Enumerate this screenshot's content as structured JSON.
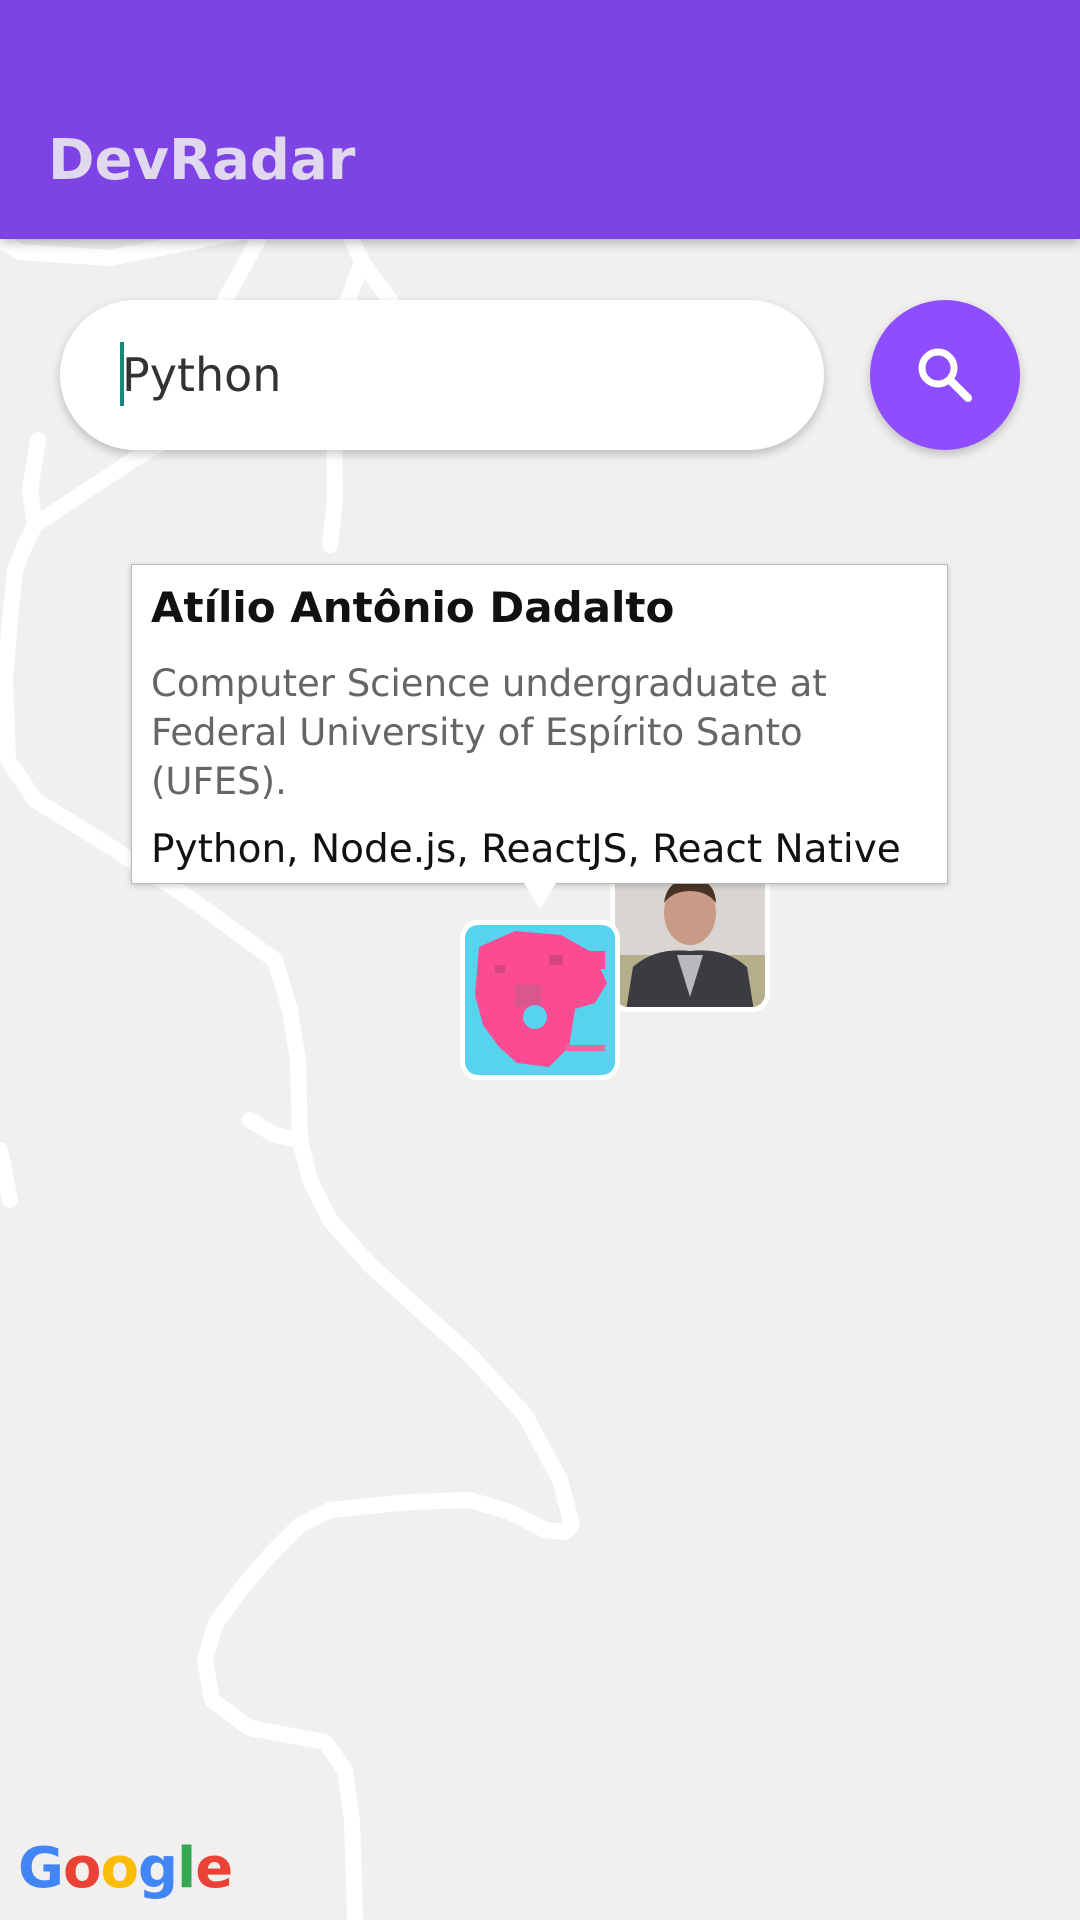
{
  "app": {
    "title": "DevRadar",
    "accent_color": "#7d43e4",
    "button_color": "#8e4dff"
  },
  "search": {
    "value": "Python",
    "button_icon": "search-icon"
  },
  "callout": {
    "name": "Atílio Antônio Dadalto",
    "bio": "Computer Science undergraduate at Federal University of Espírito Santo (UFES).",
    "techs": "Python, Node.js, ReactJS, React Native"
  },
  "markers": [
    {
      "icon": "developer-photo-avatar"
    },
    {
      "icon": "pink-cyan-pixel-avatar"
    }
  ],
  "map": {
    "attribution": "Google"
  }
}
